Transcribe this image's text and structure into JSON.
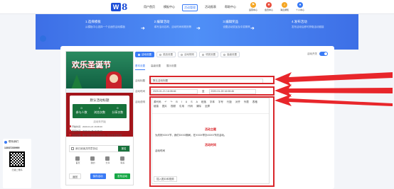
{
  "brand": {
    "mark": "W",
    "num": "8"
  },
  "nav": {
    "links": [
      "用户首页",
      "模板中心",
      "活动管理",
      "活动报表",
      "帮助中心"
    ],
    "icons": [
      {
        "name": "flag-icon",
        "label": "运营中心",
        "color": "#f5a623"
      },
      {
        "name": "star-icon",
        "label": "会员中心",
        "color": "#e94e3c"
      },
      {
        "name": "bell-icon",
        "label": "消息通知",
        "color": "#f5a623"
      },
      {
        "name": "user-icon",
        "label": "个人中心",
        "color": "#3a7bf5"
      }
    ]
  },
  "steps": [
    {
      "title": "1.选择模板",
      "desc": "从模板中心选择一个合适的活动模板"
    },
    {
      "title": "2.编辑活动",
      "desc": "填写活动名称、活动时间和规则等"
    },
    {
      "title": "3.编辑奖品",
      "desc": "设置活动奖品及中奖概率"
    },
    {
      "title": "4.发布活动",
      "desc": "发布活动后即可获取活动链接"
    }
  ],
  "phone": {
    "banner_title": "欢乐圣诞节",
    "activity_title": "默认活动标题",
    "stats": [
      {
        "v": "0",
        "l": "参与人数"
      },
      {
        "v": "0",
        "l": "浏览次数"
      },
      {
        "v": "0",
        "l": "分享次数"
      }
    ],
    "status": "活动未开始",
    "info": [
      "开始时间：2020-01-21 16:08:46",
      "结束时间：2020-01-28 16:08:46",
      "活动说明：每个用户最多可参与1次，可以分享给好友"
    ],
    "join_label": "我已阅读并同意协议",
    "join_btn": "报名",
    "shortcuts": [
      "首页",
      "我的",
      "分享",
      "联系"
    ],
    "bottom": [
      "返回",
      "保存活动",
      "发布活动"
    ]
  },
  "tabs": [
    "活动设置",
    "奖品设置",
    "活动规则",
    "领奖设置",
    "高级设置"
  ],
  "toggle_label": "活动开关",
  "subtabs": [
    "基本设置",
    "高级设置",
    "展示设置"
  ],
  "form": {
    "name_label": "活动标题",
    "name_value": "默认活动标题",
    "time_label": "活动时间",
    "start": "2020-01-21 16:08:46",
    "sep": "至",
    "end": "2020-01-28 16:08:46",
    "desc_label": "活动说明"
  },
  "editor": {
    "toolbar": [
      "源代码",
      "↶",
      "↷",
      "B",
      "I",
      "U",
      "S",
      "A",
      "段落",
      "字体",
      "字号",
      "行距",
      "对齐",
      "列表",
      "表格",
      "链接",
      "图片",
      "视频",
      "引用",
      "代码",
      "清除",
      "全屏"
    ],
    "h1": "活动主题",
    "p1": "为庆祝XXXX节，我们XXXX期间，在XXXX举办XXXX节庆活动。",
    "h2": "活动时间",
    "p2": "活动时间",
    "footer": "插入图片和视频"
  },
  "contact": {
    "title": "联系我们",
    "phone": "13037239999",
    "caption": "扫描二维码"
  }
}
